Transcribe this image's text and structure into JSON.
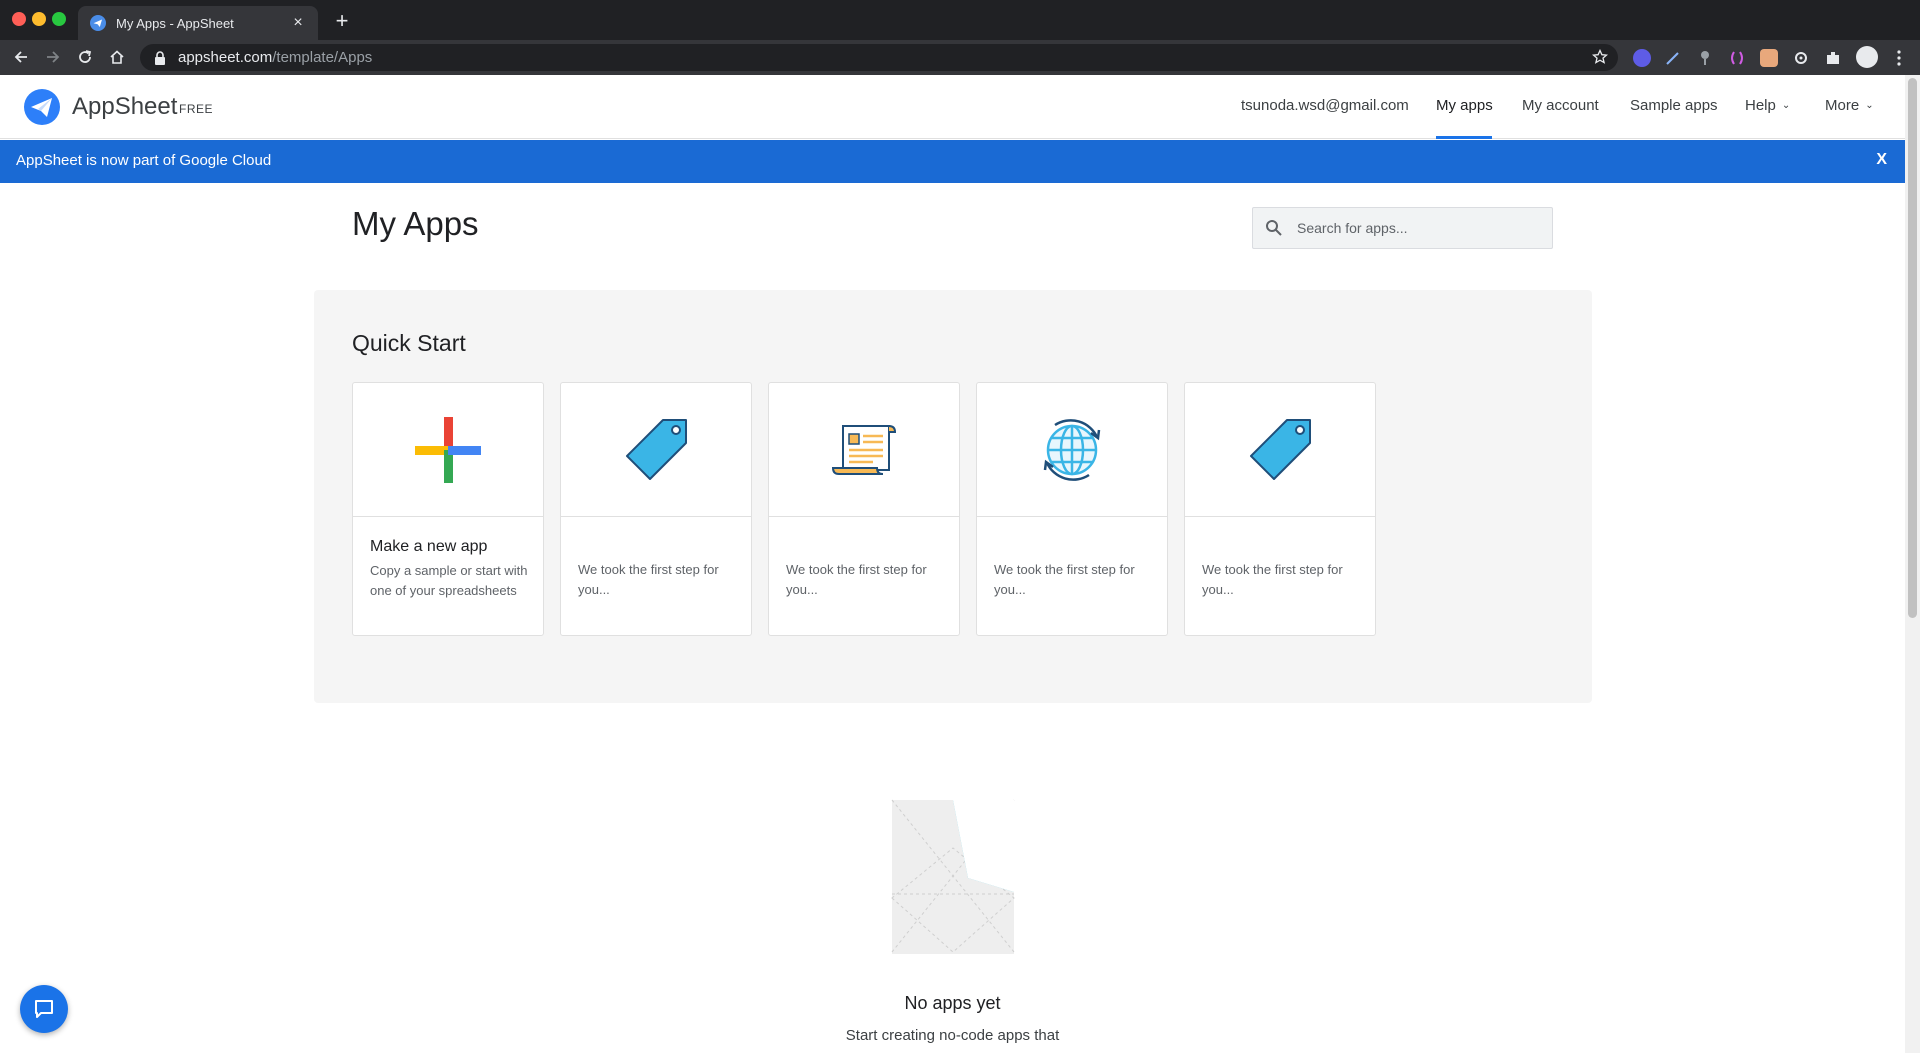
{
  "browser": {
    "tab_title": "My Apps - AppSheet",
    "tab_close": "×",
    "new_tab": "+",
    "url_host": "appsheet.com",
    "url_path": "/template/Apps"
  },
  "header": {
    "brand": "AppSheet",
    "plan": "FREE",
    "nav": {
      "email": "tsunoda.wsd@gmail.com",
      "my_apps": "My apps",
      "my_account": "My account",
      "sample_apps": "Sample apps",
      "help": "Help",
      "more": "More"
    },
    "accent_color": "#1a73e8"
  },
  "banner": {
    "text": "AppSheet is now part of Google Cloud",
    "close_label": "X",
    "color": "#1a6ad4"
  },
  "main": {
    "title": "My Apps",
    "search": {
      "placeholder": "Search for apps..."
    }
  },
  "quick_start": {
    "title": "Quick Start",
    "cards": [
      {
        "icon": "plus-icon",
        "title": "Make a new app",
        "description": "Copy a sample or start with one of your spreadsheets"
      },
      {
        "icon": "price-tag-icon",
        "description": "We took the first step for you..."
      },
      {
        "icon": "scroll-document-icon",
        "description": "We took the first step for you..."
      },
      {
        "icon": "globe-sync-icon",
        "description": "We took the first step for you..."
      },
      {
        "icon": "price-tag-icon",
        "description": "We took the first step for you..."
      }
    ]
  },
  "empty_state": {
    "title": "No apps yet",
    "subtitle": "Start creating no-code apps that"
  }
}
